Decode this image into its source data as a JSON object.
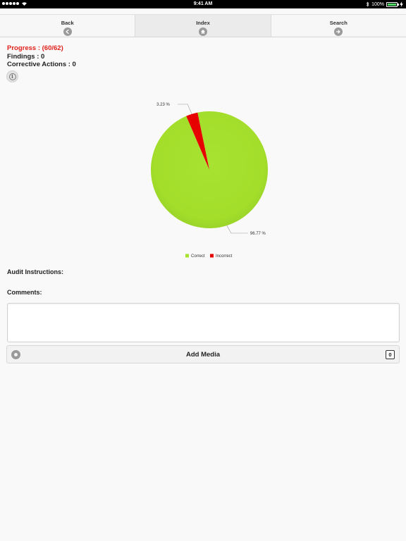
{
  "status_bar": {
    "time": "9:41 AM",
    "battery": "100%"
  },
  "nav": {
    "tabs": [
      {
        "label": "Back",
        "icon": "back-arrow-icon"
      },
      {
        "label": "Index",
        "icon": "home-icon"
      },
      {
        "label": "Search",
        "icon": "forward-arrow-icon"
      }
    ]
  },
  "info": {
    "progress": "Progress : (60/62)",
    "findings": "Findings : 0",
    "corrective_actions": "Corrective Actions : 0"
  },
  "labels": {
    "audit_instructions": "Audit Instructions:",
    "comments": "Comments:"
  },
  "comments": {
    "value": ""
  },
  "media": {
    "label": "Add Media",
    "count": "0"
  },
  "colors": {
    "correct": "#a6e22e",
    "incorrect": "#e60000",
    "progress_text": "#e0201b"
  },
  "chart_data": {
    "type": "pie",
    "slices": [
      {
        "name": "Correct",
        "value": 96.77,
        "label": "96.77 %",
        "color": "#a6e22e"
      },
      {
        "name": "Incorrect",
        "value": 3.23,
        "label": "3.23 %",
        "color": "#e60000"
      }
    ],
    "legend": [
      "Correct",
      "Incorrect"
    ],
    "legend_position": "bottom"
  }
}
